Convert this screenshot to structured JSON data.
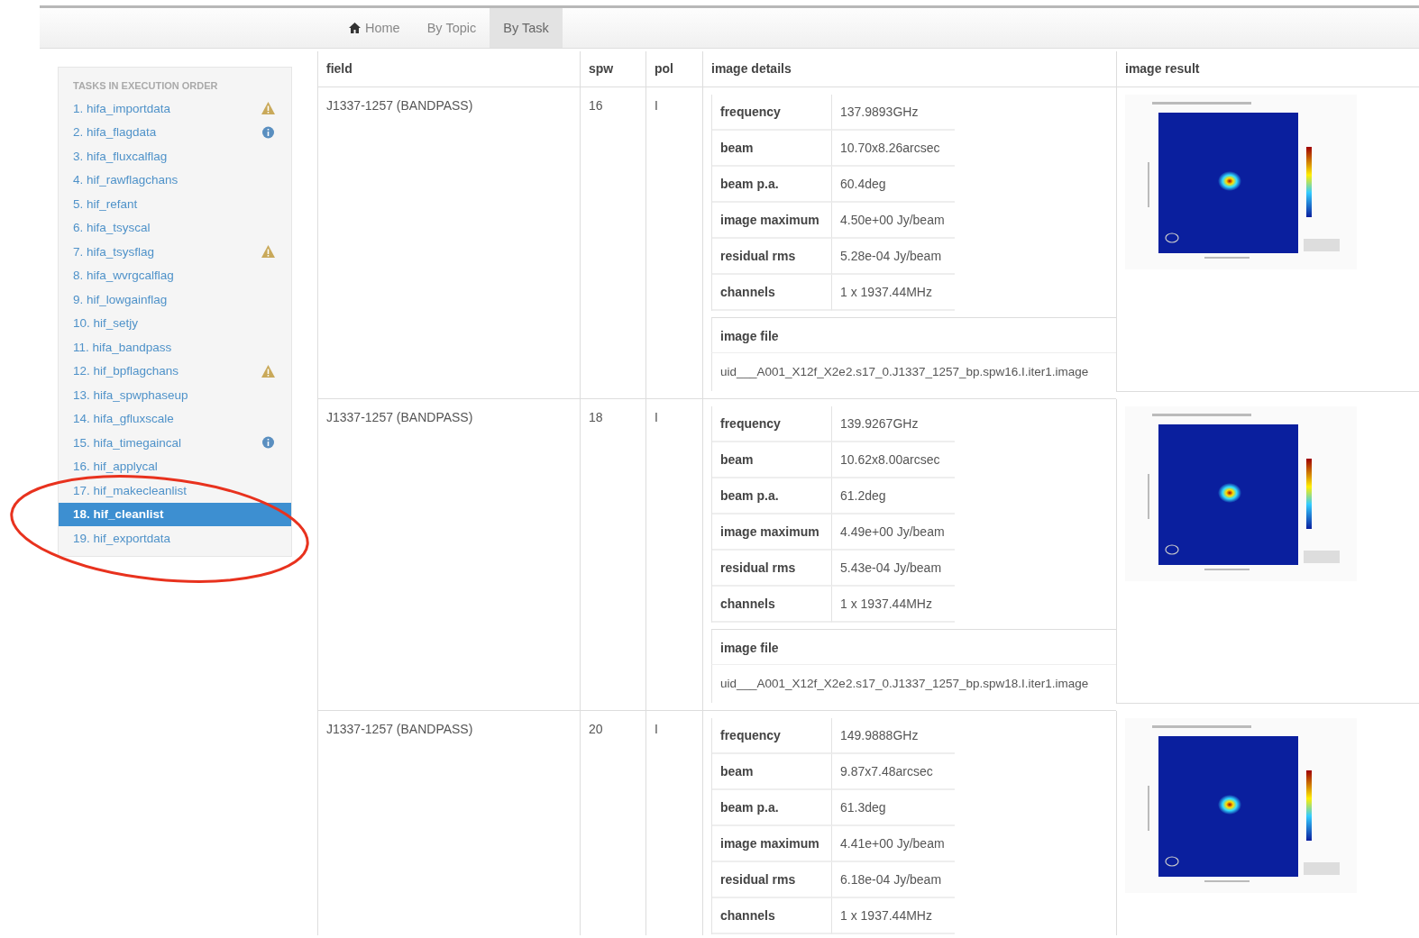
{
  "nav": [
    {
      "label": "Home",
      "kind": "home",
      "selected": false
    },
    {
      "label": "By Topic",
      "kind": "plain",
      "selected": false
    },
    {
      "label": "By Task",
      "kind": "plain",
      "selected": true
    }
  ],
  "sidebar": {
    "title": "TASKS IN EXECUTION ORDER",
    "items": [
      {
        "label": "1. hifa_importdata",
        "kind": "warning",
        "selected": false
      },
      {
        "label": "2. hifa_flagdata",
        "kind": "info",
        "selected": false
      },
      {
        "label": "3. hifa_fluxcalflag",
        "selected": false
      },
      {
        "label": "4. hif_rawflagchans",
        "selected": false
      },
      {
        "label": "5. hif_refant",
        "selected": false
      },
      {
        "label": "6. hifa_tsyscal",
        "selected": false
      },
      {
        "label": "7. hifa_tsysflag",
        "kind": "warning",
        "selected": false
      },
      {
        "label": "8. hifa_wvrgcalflag",
        "selected": false
      },
      {
        "label": "9. hif_lowgainflag",
        "selected": false
      },
      {
        "label": "10. hif_setjy",
        "selected": false
      },
      {
        "label": "11. hifa_bandpass",
        "selected": false
      },
      {
        "label": "12. hif_bpflagchans",
        "kind": "warning",
        "selected": false
      },
      {
        "label": "13. hifa_spwphaseup",
        "selected": false
      },
      {
        "label": "14. hifa_gfluxscale",
        "selected": false
      },
      {
        "label": "15. hifa_timegaincal",
        "kind": "info",
        "selected": false
      },
      {
        "label": "16. hif_applycal",
        "selected": false
      },
      {
        "label": "17. hif_makecleanlist",
        "selected": false
      },
      {
        "label": "18. hif_cleanlist",
        "selected": true
      },
      {
        "label": "19. hif_exportdata",
        "selected": false
      }
    ]
  },
  "annotation": {
    "kind": "ellipse",
    "color": "#e8321e"
  },
  "table": {
    "columns": [
      "field",
      "spw",
      "pol",
      "image details",
      "image result"
    ],
    "rows": [
      {
        "field": "J1337-1257 (BANDPASS)",
        "spw": "16",
        "pol": "I",
        "details": [
          {
            "label": "frequency",
            "value": "137.9893GHz"
          },
          {
            "label": "beam",
            "value": "10.70x8.26arcsec"
          },
          {
            "label": "beam p.a.",
            "value": "60.4deg"
          },
          {
            "label": "image maximum",
            "value": "4.50e+00 Jy/beam"
          },
          {
            "label": "residual rms",
            "value": "5.28e-04 Jy/beam"
          },
          {
            "label": "channels",
            "value": "1 x 1937.44MHz"
          }
        ],
        "image_file": {
          "label": "image file",
          "value": "uid___A001_X12f_X2e2.s17_0.J1337_1257_bp.spw16.I.iter1.image"
        },
        "result": {
          "kind": "plot"
        }
      },
      {
        "field": "J1337-1257 (BANDPASS)",
        "spw": "18",
        "pol": "I",
        "details": [
          {
            "label": "frequency",
            "value": "139.9267GHz"
          },
          {
            "label": "beam",
            "value": "10.62x8.00arcsec"
          },
          {
            "label": "beam p.a.",
            "value": "61.2deg"
          },
          {
            "label": "image maximum",
            "value": "4.49e+00 Jy/beam"
          },
          {
            "label": "residual rms",
            "value": "5.43e-04 Jy/beam"
          },
          {
            "label": "channels",
            "value": "1 x 1937.44MHz"
          }
        ],
        "image_file": {
          "label": "image file",
          "value": "uid___A001_X12f_X2e2.s17_0.J1337_1257_bp.spw18.I.iter1.image"
        },
        "result": {
          "kind": "plot"
        }
      },
      {
        "field": "J1337-1257 (BANDPASS)",
        "spw": "20",
        "pol": "I",
        "details": [
          {
            "label": "frequency",
            "value": "149.9888GHz"
          },
          {
            "label": "beam",
            "value": "9.87x7.48arcsec"
          },
          {
            "label": "beam p.a.",
            "value": "61.3deg"
          },
          {
            "label": "image maximum",
            "value": "4.41e+00 Jy/beam"
          },
          {
            "label": "residual rms",
            "value": "6.18e-04 Jy/beam"
          },
          {
            "label": "channels",
            "value": "1 x 1937.44MHz"
          }
        ],
        "result": {
          "kind": "plot"
        }
      }
    ]
  }
}
